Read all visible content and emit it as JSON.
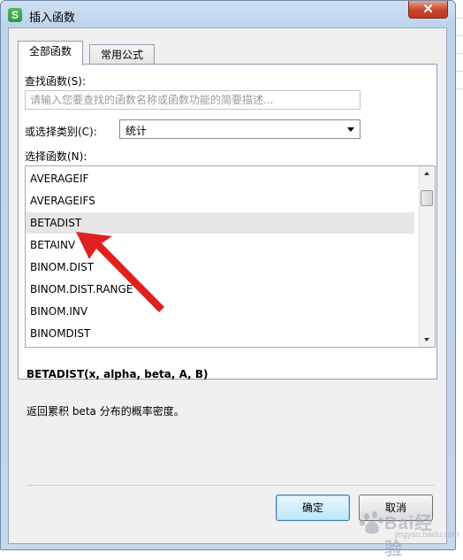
{
  "window": {
    "title": "插入函数",
    "app_icon_letter": "S",
    "close_glyph": "✕"
  },
  "tabs": [
    {
      "label": "全部函数",
      "active": true
    },
    {
      "label": "常用公式",
      "active": false
    }
  ],
  "search": {
    "label": "查找函数(S):",
    "placeholder": "请输入您要查找的函数名称或函数功能的简要描述..."
  },
  "category": {
    "label": "或选择类别(C):",
    "selected": "统计"
  },
  "function_list": {
    "label": "选择函数(N):",
    "items": [
      "AVERAGEIF",
      "AVERAGEIFS",
      "BETADIST",
      "BETAINV",
      "BINOM.DIST",
      "BINOM.DIST.RANGE",
      "BINOM.INV",
      "BINOMDIST"
    ],
    "selected": "BETADIST"
  },
  "signature": "BETADIST(x, alpha, beta, A, B)",
  "description": "返回累积 beta 分布的概率密度。",
  "buttons": {
    "ok": "确定",
    "cancel": "取消"
  },
  "watermark": {
    "text": "Bai经验",
    "sub": "jingyan.baidu.com"
  },
  "colors": {
    "annotation_arrow": "#e02020",
    "selection": "#e6e6e6",
    "title_bar": "#bcd3ec",
    "close_button": "#c7452d"
  }
}
